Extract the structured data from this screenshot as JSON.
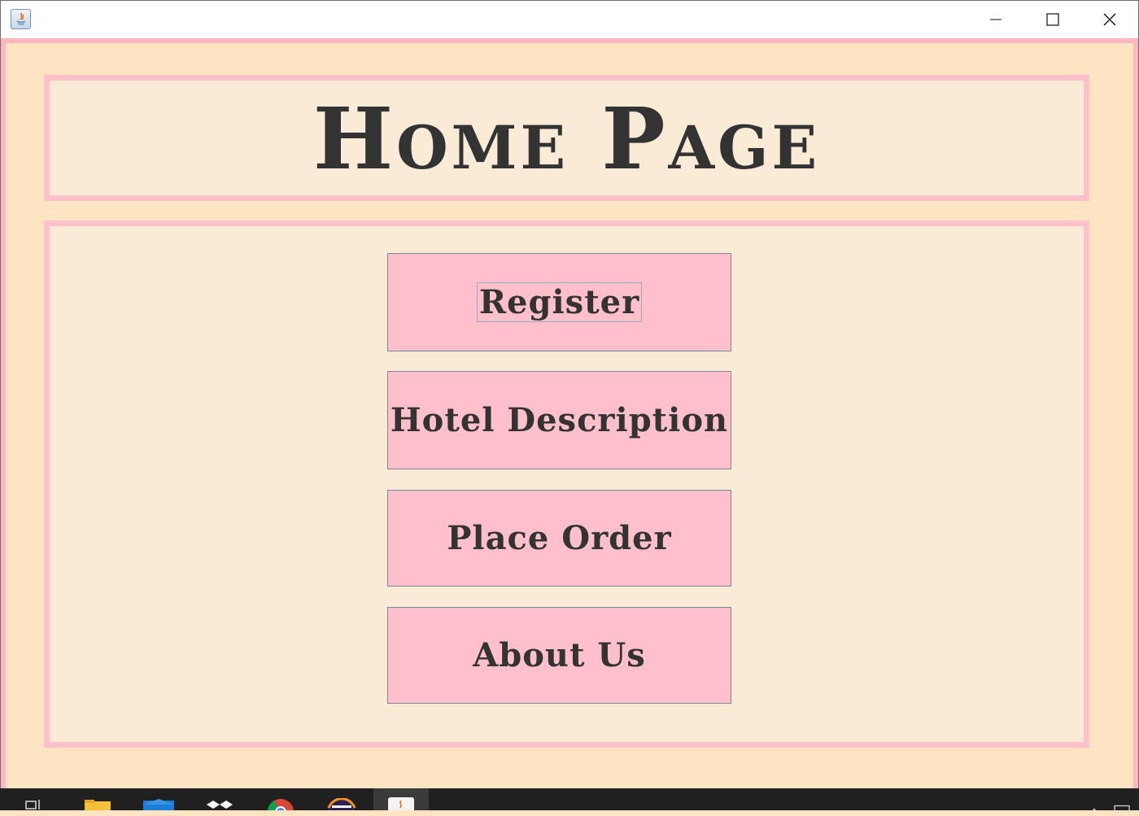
{
  "window": {
    "app_icon": "java-icon",
    "controls": {
      "minimize": "minimize-icon",
      "maximize": "maximize-icon",
      "close": "close-icon"
    }
  },
  "header": {
    "title": "Home Page"
  },
  "menu": {
    "buttons": [
      {
        "label": "Register"
      },
      {
        "label": "Hotel Description"
      },
      {
        "label": "Place Order"
      },
      {
        "label": "About Us"
      }
    ]
  },
  "taskbar": {
    "items": [
      "task-view-icon",
      "file-explorer-icon",
      "mail-icon",
      "dropbox-icon",
      "chrome-icon",
      "eclipse-icon",
      "java-icon"
    ]
  },
  "colors": {
    "background": "#ffe4c4",
    "panel": "#faebd7",
    "border": "#ffc0cb",
    "button": "#ffc0cb",
    "text": "#333333"
  }
}
